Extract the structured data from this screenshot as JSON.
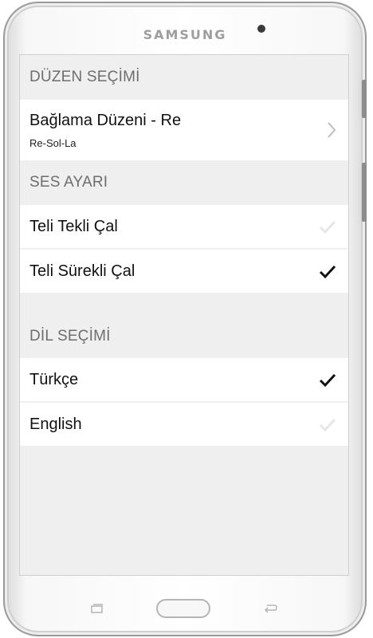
{
  "device": {
    "brand": "SAMSUNG"
  },
  "sections": {
    "tuning": {
      "title": "DÜZEN SEÇİMİ",
      "item": {
        "label": "Bağlama Düzeni - Re",
        "sublabel": "Re-Sol-La",
        "icon": "chevron-right-icon"
      }
    },
    "sound": {
      "title": "SES AYARI",
      "items": [
        {
          "label": "Teli Tekli Çal",
          "checked": false
        },
        {
          "label": "Teli Sürekli Çal",
          "checked": true
        }
      ]
    },
    "language": {
      "title": "DİL SEÇİMİ",
      "items": [
        {
          "label": "Türkçe",
          "checked": true
        },
        {
          "label": "English",
          "checked": false
        }
      ]
    }
  },
  "colors": {
    "checked": "#111111",
    "unchecked": "#e6e6e6",
    "section_title": "#6e6e6e",
    "background": "#efefef"
  },
  "nav_icons": [
    "recent-apps-icon",
    "home-button",
    "back-icon"
  ]
}
